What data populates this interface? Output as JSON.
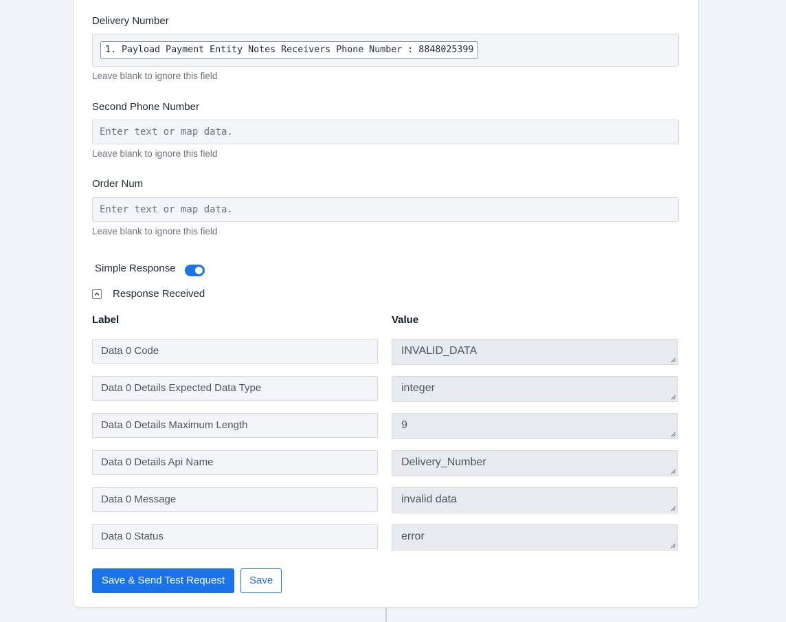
{
  "fields": [
    {
      "label": "Delivery Number",
      "mapped_value": "1. Payload Payment Entity Notes Receivers Phone Number : 8848025399",
      "hint": "Leave blank to ignore this field"
    },
    {
      "label": "Second Phone Number",
      "placeholder": "Enter text or map data.",
      "hint": "Leave blank to ignore this field"
    },
    {
      "label": "Order Num",
      "placeholder": "Enter text or map data.",
      "hint": "Leave blank to ignore this field"
    }
  ],
  "simple_response": {
    "label": "Simple Response",
    "enabled": true
  },
  "response_received": {
    "label": "Response Received",
    "expanded": true,
    "icon": "chevron-up-icon"
  },
  "response_table": {
    "headers": {
      "label": "Label",
      "value": "Value"
    },
    "rows": [
      {
        "label": "Data 0 Code",
        "value": "INVALID_DATA"
      },
      {
        "label": "Data 0 Details Expected Data Type",
        "value": "integer"
      },
      {
        "label": "Data 0 Details Maximum Length",
        "value": "9"
      },
      {
        "label": "Data 0 Details Api Name",
        "value": "Delivery_Number"
      },
      {
        "label": "Data 0 Message",
        "value": "invalid data"
      },
      {
        "label": "Data 0 Status",
        "value": "error"
      }
    ]
  },
  "actions": {
    "primary_label": "Save & Send Test Request",
    "secondary_label": "Save"
  },
  "colors": {
    "accent": "#1a73e8",
    "background": "#f1f4f8",
    "field_bg": "#f3f5f8",
    "value_bg": "#e7eaee"
  }
}
